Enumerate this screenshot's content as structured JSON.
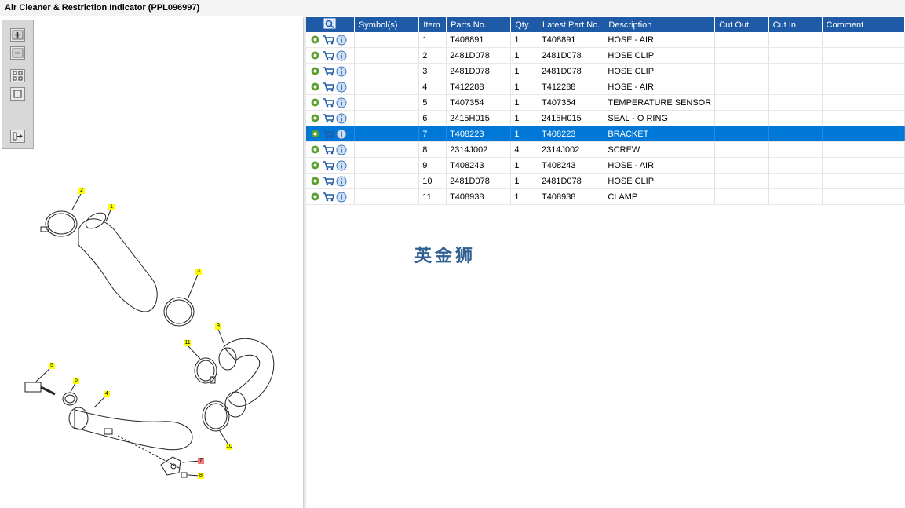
{
  "window": {
    "title": "Air Cleaner & Restriction Indicator (PPL096997)"
  },
  "toolbar": {
    "buttons": [
      "zoom-in-icon",
      "zoom-out-icon",
      "fit-page-icon",
      "actual-size-icon",
      "export-icon"
    ]
  },
  "diagram": {
    "callouts": [
      "2",
      "1",
      "3",
      "9",
      "11",
      "5",
      "6",
      "4",
      "10",
      "7",
      "8"
    ]
  },
  "table": {
    "columns": [
      "",
      "Symbol(s)",
      "Item",
      "Parts No.",
      "Qty.",
      "Latest Part No.",
      "Description",
      "Cut Out",
      "Cut In",
      "Comment"
    ],
    "rows": [
      {
        "item": "1",
        "part": "T408891",
        "qty": "1",
        "latest": "T408891",
        "desc": "HOSE - AIR"
      },
      {
        "item": "2",
        "part": "2481D078",
        "qty": "1",
        "latest": "2481D078",
        "desc": "HOSE CLIP"
      },
      {
        "item": "3",
        "part": "2481D078",
        "qty": "1",
        "latest": "2481D078",
        "desc": "HOSE CLIP"
      },
      {
        "item": "4",
        "part": "T412288",
        "qty": "1",
        "latest": "T412288",
        "desc": "HOSE - AIR"
      },
      {
        "item": "5",
        "part": "T407354",
        "qty": "1",
        "latest": "T407354",
        "desc": "TEMPERATURE SENSOR"
      },
      {
        "item": "6",
        "part": "2415H015",
        "qty": "1",
        "latest": "2415H015",
        "desc": "SEAL - O RING"
      },
      {
        "item": "7",
        "part": "T408223",
        "qty": "1",
        "latest": "T408223",
        "desc": "BRACKET"
      },
      {
        "item": "8",
        "part": "2314J002",
        "qty": "4",
        "latest": "2314J002",
        "desc": "SCREW"
      },
      {
        "item": "9",
        "part": "T408243",
        "qty": "1",
        "latest": "T408243",
        "desc": "HOSE - AIR"
      },
      {
        "item": "10",
        "part": "2481D078",
        "qty": "1",
        "latest": "2481D078",
        "desc": "HOSE CLIP"
      },
      {
        "item": "11",
        "part": "T408938",
        "qty": "1",
        "latest": "T408938",
        "desc": "CLAMP"
      }
    ],
    "selected_index": 6
  },
  "watermark": "英金狮",
  "colors": {
    "header_bg": "#1f5aa6",
    "selected_row": "#0078d7",
    "callout": "#ffff00",
    "callout_selected": "#f07a7a"
  }
}
